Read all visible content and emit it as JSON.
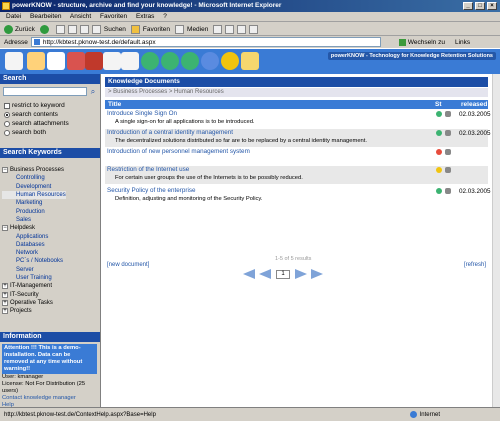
{
  "window": {
    "title": "powerKNOW - structure, archive and find your knowledge! - Microsoft Internet Explorer"
  },
  "menu": [
    "Datei",
    "Bearbeiten",
    "Ansicht",
    "Favoriten",
    "Extras",
    "?"
  ],
  "toolbar": {
    "back": "Zurück",
    "search": "Suchen",
    "favorites": "Favoriten",
    "media": "Medien"
  },
  "address": {
    "label": "Adresse",
    "url": "http://kbtest.pknow-test.de/default.aspx",
    "go": "Wechseln zu",
    "links": "Links"
  },
  "app": {
    "logo": "powerKNOW - Technology for Knowledge Retention Solutions"
  },
  "sidebar": {
    "search_header": "Search",
    "options": [
      "restrict to keyword",
      "search contents",
      "search attachments",
      "search both"
    ],
    "keywords_header": "Search Keywords",
    "tree": [
      {
        "label": "Business Processes",
        "sign": "−",
        "level": 0
      },
      {
        "label": "Controlling",
        "level": 1
      },
      {
        "label": "Development",
        "level": 1
      },
      {
        "label": "Human Resources",
        "level": 1,
        "selected": true
      },
      {
        "label": "Marketing",
        "level": 1
      },
      {
        "label": "Production",
        "level": 1
      },
      {
        "label": "Sales",
        "level": 1
      },
      {
        "label": "Helpdesk",
        "sign": "−",
        "level": 0
      },
      {
        "label": "Applications",
        "level": 1
      },
      {
        "label": "Databases",
        "level": 1
      },
      {
        "label": "Network",
        "level": 1
      },
      {
        "label": "PC´s / Notebooks",
        "level": 1
      },
      {
        "label": "Server",
        "level": 1
      },
      {
        "label": "User Training",
        "level": 1
      },
      {
        "label": "IT-Management",
        "sign": "+",
        "level": 0
      },
      {
        "label": "IT-Security",
        "sign": "+",
        "level": 0
      },
      {
        "label": "Operative Tasks",
        "sign": "+",
        "level": 0
      },
      {
        "label": "Projects",
        "sign": "+",
        "level": 0
      }
    ],
    "info_header": "Information",
    "attention": "Attention !!! This is a demo-installation. Data can be removed at any time without warning!!",
    "user": "User: kmanager",
    "license": "License: Not For Distribution (25 users)",
    "contact": "Contact knowledge manager",
    "help": "Help"
  },
  "main": {
    "header": "Knowledge Documents",
    "breadcrumb": "> Business Processes > Human Resources",
    "columns": {
      "title": "Title",
      "status": "St",
      "released": "released"
    },
    "rows": [
      {
        "title": "Introduce Single Sign On",
        "desc": "A single sign-on for all applications is to be introduced.",
        "date": "02.03.2005",
        "status": "green"
      },
      {
        "title": "Introduction of a central identity management",
        "desc": "The decentralized solutions distributed so far are to be replaced by a central identity management.",
        "date": "02.03.2005",
        "status": "green"
      },
      {
        "title": "Introduction of new personnel management system",
        "desc": "",
        "date": "",
        "status": "red"
      },
      {
        "title": "Restriction of the Internet use",
        "desc": "For certain user groups the use of the Internets is to be possibly reduced.",
        "date": "",
        "status": "yellow"
      },
      {
        "title": "Security Policy of the enterprise",
        "desc": "Definition, adjusting and monitoring of the Security Policy.",
        "date": "02.03.2005",
        "status": "green"
      }
    ],
    "count": "1-5 of 5 results",
    "new_doc": "[new document]",
    "refresh": "[refresh]",
    "page": "1"
  },
  "status": {
    "url": "http://kbtest.pknow-test.de/ContextHelp.aspx?Base=Help",
    "zone": "Internet"
  }
}
